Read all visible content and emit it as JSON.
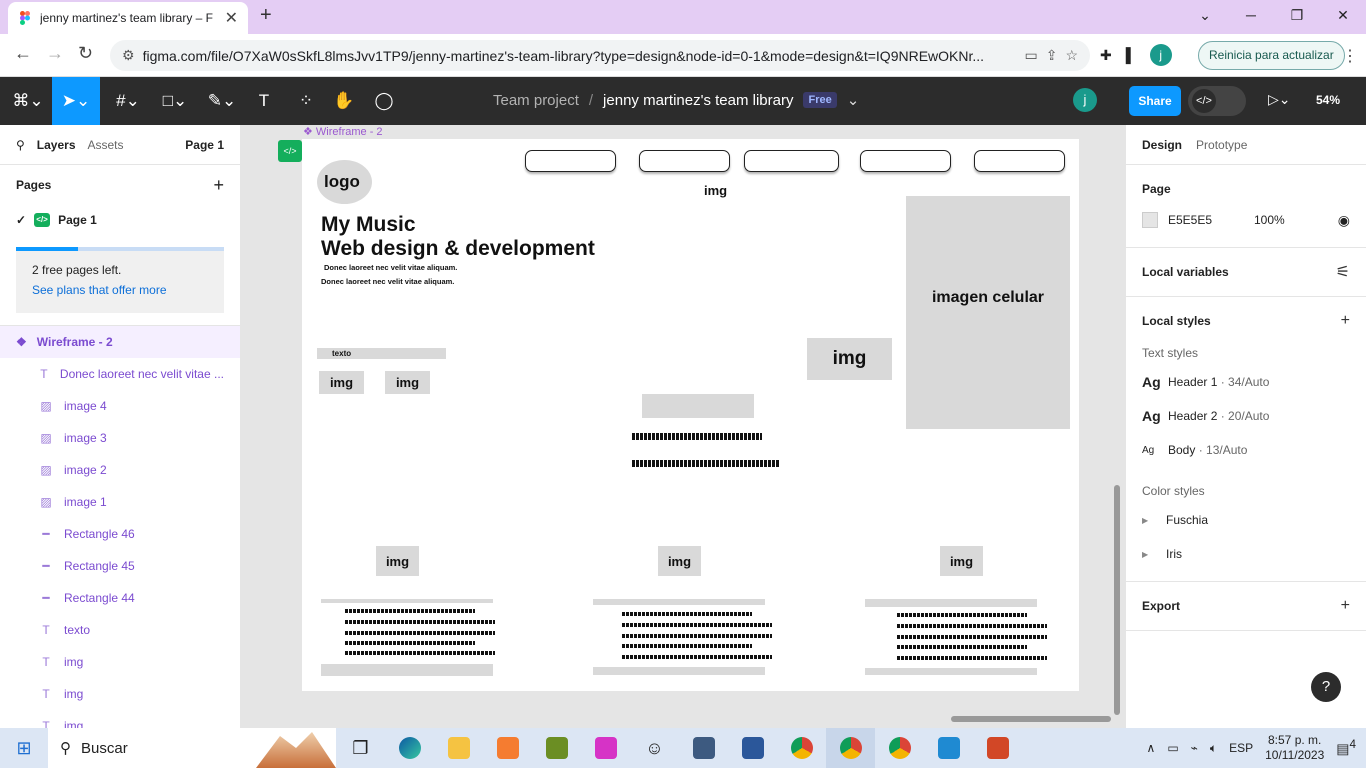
{
  "browser": {
    "tab_title": "jenny martinez's team library – F",
    "new_tab": "+",
    "url": "figma.com/file/O7XaW0sSkfL8lmsJvv1TP9/jenny-martinez's-team-library?type=design&node-id=0-1&mode=design&t=IQ9NREwOKNr...",
    "profile_initial": "j",
    "update_button": "Reinicia para actualizar"
  },
  "figma_toolbar": {
    "project": "Team project",
    "separator": "/",
    "file_name": "jenny martinez's team library",
    "plan_badge": "Free",
    "user_initial": "j",
    "share": "Share",
    "zoom": "54%"
  },
  "left_panel": {
    "tab_layers": "Layers",
    "tab_assets": "Assets",
    "page_selector": "Page 1",
    "pages_title": "Pages",
    "pages": [
      {
        "name": "Page 1"
      }
    ],
    "free_pages_text": "2 free pages left.",
    "free_pages_link": "See plans that offer more",
    "frame_name": "Wireframe - 2",
    "layers": [
      {
        "name": "Donec laoreet nec velit vitae ...",
        "icon": "text-icon"
      },
      {
        "name": "image 4",
        "icon": "image-icon"
      },
      {
        "name": "image 3",
        "icon": "image-icon"
      },
      {
        "name": "image 2",
        "icon": "image-icon"
      },
      {
        "name": "image 1",
        "icon": "image-icon"
      },
      {
        "name": "Rectangle 46",
        "icon": "line-icon"
      },
      {
        "name": "Rectangle 45",
        "icon": "line-icon"
      },
      {
        "name": "Rectangle 44",
        "icon": "line-icon"
      },
      {
        "name": "texto",
        "icon": "text-icon"
      },
      {
        "name": "img",
        "icon": "text-icon"
      },
      {
        "name": "img",
        "icon": "text-icon"
      },
      {
        "name": "img",
        "icon": "text-icon"
      }
    ]
  },
  "canvas": {
    "frame_label": "Wireframe - 2",
    "logo": "logo",
    "nav_img": "img",
    "headline_1": "My Music",
    "headline_2": "Web design & development",
    "body_1": "Donec laoreet nec velit vitae aliquam.",
    "body_2": "Donec laoreet nec velit vitae aliquam.",
    "phone_image": "imagen celular",
    "img_label": "img",
    "texto": "texto"
  },
  "right_panel": {
    "tab_design": "Design",
    "tab_prototype": "Prototype",
    "page_title": "Page",
    "page_color": "E5E5E5",
    "page_opacity": "100%",
    "local_variables": "Local variables",
    "local_styles": "Local styles",
    "text_styles_title": "Text styles",
    "text_styles": [
      {
        "name": "Header 1",
        "meta": " · 34/Auto"
      },
      {
        "name": "Header 2",
        "meta": " · 20/Auto"
      },
      {
        "name": "Body",
        "meta": " · 13/Auto"
      }
    ],
    "color_styles_title": "Color styles",
    "color_styles": [
      {
        "name": "Fuschia"
      },
      {
        "name": "Iris"
      }
    ],
    "export": "Export",
    "help": "?"
  },
  "taskbar": {
    "search": "Buscar",
    "language": "ESP",
    "time": "8:57 p. m.",
    "date": "10/11/2023",
    "notifications": "4"
  },
  "colors": {
    "figma_blue": "#0d99ff",
    "figma_dark": "#2c2c2c",
    "purple_layer": "#7b4bd0",
    "chrome_frame": "#e4cdf4",
    "placeholder_gray": "#d9d9d9"
  }
}
